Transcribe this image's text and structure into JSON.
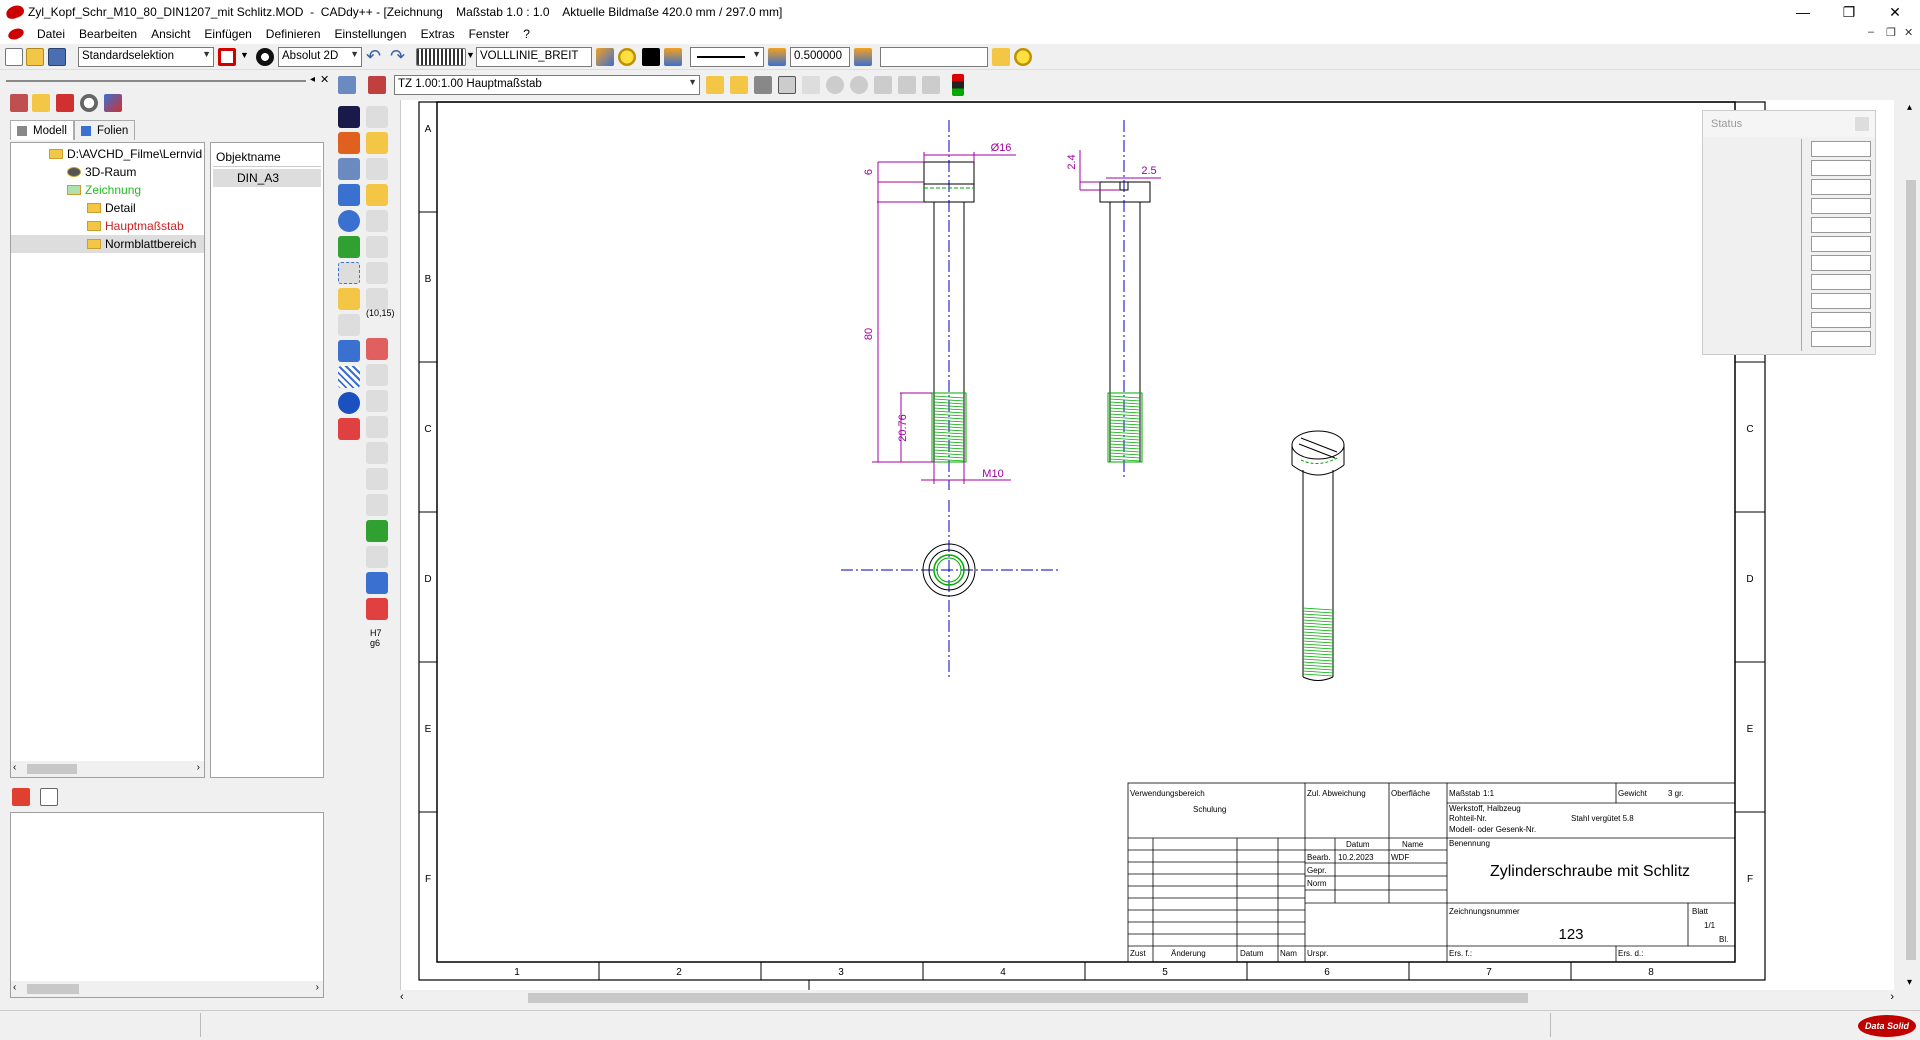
{
  "window": {
    "title": "Zyl_Kopf_Schr_M10_80_DIN1207_mit Schlitz.MOD  -  CADdy++ - [Zeichnung    Maßstab 1.0 : 1.0    Aktuelle Bildmaße 420.0 mm / 297.0 mm]",
    "minimize": "—",
    "maximize": "❐",
    "close": "✕"
  },
  "menu": [
    "Datei",
    "Bearbeiten",
    "Ansicht",
    "Einfügen",
    "Definieren",
    "Einstellungen",
    "Extras",
    "Fenster",
    "?"
  ],
  "toolbar": {
    "selection_mode": "Standardselektion",
    "coord_mode": "Absolut 2D",
    "line_type": "VOLLLINIE_BREIT",
    "line_width": "0.500000",
    "text_field": ""
  },
  "toolbar2": {
    "scale_combo": "TZ 1.00:1.00 Hauptmaßstab"
  },
  "panel": {
    "tabs": [
      "Modell",
      "Folien"
    ],
    "tree": {
      "root": "D:\\AVCHD_Filme\\Lernvid",
      "items": [
        "3D-Raum",
        "Zeichnung",
        "Detail",
        "Hauptmaßstab",
        "Normblattbereich"
      ]
    },
    "objects_header": "Objektname",
    "objects": [
      "DIN_A3"
    ]
  },
  "vtools": {
    "coord_label": "(10,15)",
    "fit_label": "H7 g6"
  },
  "status_panel": {
    "title": "Status"
  },
  "drawing": {
    "dims": {
      "d16": "Ø16",
      "six": "6",
      "eighty": "80",
      "thread_len": "20.76",
      "m10": "M10",
      "two_four": "2.4",
      "two_five": "2.5"
    },
    "border_cols": [
      "1",
      "2",
      "3",
      "4",
      "5",
      "6",
      "7",
      "8"
    ],
    "border_rows": [
      "A",
      "B",
      "C",
      "D",
      "E",
      "F"
    ],
    "titleblock": {
      "verwendung": "Verwendungsbereich",
      "schulung": "Schulung",
      "zul_abw": "Zul. Abweichung",
      "oberflaeche": "Oberfläche",
      "massstab_label": "Maßstab",
      "massstab": "1:1",
      "gewicht_label": "Gewicht",
      "gewicht": "3 gr.",
      "werkstoff": "Werkstoff, Halbzeug",
      "rohteil": "Rohteil-Nr.",
      "stahl": "Stahl vergütet 5.8",
      "modell": "Modell- oder Gesenk-Nr.",
      "datum": "Datum",
      "name": "Name",
      "benennung": "Benennung",
      "bearb": "Bearb.",
      "bearb_date": "10.2.2023",
      "bearb_name": "WDF",
      "gepr": "Gepr.",
      "norm": "Norm",
      "title": "Zylinderschraube mit Schlitz",
      "zeichnungsnr_label": "Zeichnungsnummer",
      "zeichnungsnr": "123",
      "blatt": "Blatt",
      "blatt_val": "1/1",
      "bl": "Bl.",
      "zust": "Zust",
      "aenderung": "Änderung",
      "datum2": "Datum",
      "nam": "Nam",
      "urspr": "Urspr.",
      "ers_f": "Ers. f.:",
      "ers_d": "Ers. d.:"
    }
  },
  "brand": "Data Solid",
  "colors": {
    "dim": "#a000a0",
    "center": "#0000c8",
    "thread": "#00a000",
    "brand": "#c00000"
  }
}
